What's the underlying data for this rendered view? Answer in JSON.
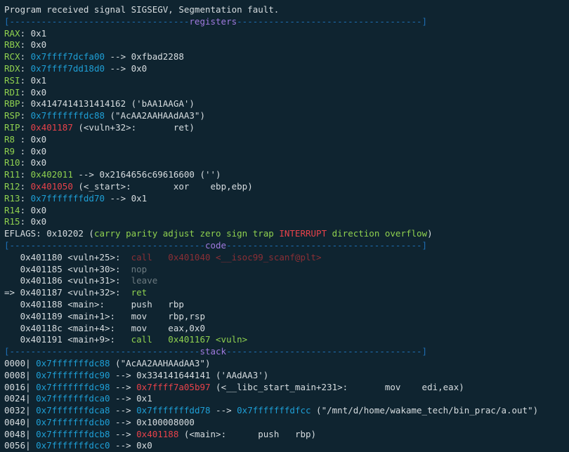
{
  "terminal": {
    "lines": [
      [
        {
          "t": "Program received signal SIGSEGV, Segmentation fault.",
          "c": "default"
        }
      ],
      [
        {
          "t": "[----------------------------------",
          "c": "sep"
        },
        {
          "t": "registers",
          "c": "purple"
        },
        {
          "t": "-----------------------------------]",
          "c": "sep"
        }
      ],
      [
        {
          "t": "RAX",
          "c": "green"
        },
        {
          "t": ": 0x1",
          "c": "default"
        }
      ],
      [
        {
          "t": "RBX",
          "c": "green"
        },
        {
          "t": ": 0x0",
          "c": "default"
        }
      ],
      [
        {
          "t": "RCX",
          "c": "green"
        },
        {
          "t": ": ",
          "c": "default"
        },
        {
          "t": "0x7ffff7dcfa00",
          "c": "blue"
        },
        {
          "t": " --> 0xfbad2288",
          "c": "default"
        }
      ],
      [
        {
          "t": "RDX",
          "c": "green"
        },
        {
          "t": ": ",
          "c": "default"
        },
        {
          "t": "0x7ffff7dd18d0",
          "c": "blue"
        },
        {
          "t": " --> 0x0",
          "c": "default"
        }
      ],
      [
        {
          "t": "RSI",
          "c": "green"
        },
        {
          "t": ": 0x1",
          "c": "default"
        }
      ],
      [
        {
          "t": "RDI",
          "c": "green"
        },
        {
          "t": ": 0x0",
          "c": "default"
        }
      ],
      [
        {
          "t": "RBP",
          "c": "green"
        },
        {
          "t": ": 0x4147414131414162 ('bAA1AAGA')",
          "c": "default"
        }
      ],
      [
        {
          "t": "RSP",
          "c": "green"
        },
        {
          "t": ": ",
          "c": "default"
        },
        {
          "t": "0x7fffffffdc88",
          "c": "blue"
        },
        {
          "t": " (\"AcAA2AAHAAdAA3\")",
          "c": "default"
        }
      ],
      [
        {
          "t": "RIP",
          "c": "green"
        },
        {
          "t": ": ",
          "c": "default"
        },
        {
          "t": "0x401187",
          "c": "red"
        },
        {
          "t": " (<vuln+32>:       ret)",
          "c": "default"
        }
      ],
      [
        {
          "t": "R8 ",
          "c": "green"
        },
        {
          "t": ": 0x0",
          "c": "default"
        }
      ],
      [
        {
          "t": "R9 ",
          "c": "green"
        },
        {
          "t": ": 0x0",
          "c": "default"
        }
      ],
      [
        {
          "t": "R10",
          "c": "green"
        },
        {
          "t": ": 0x0",
          "c": "default"
        }
      ],
      [
        {
          "t": "R11",
          "c": "green"
        },
        {
          "t": ": ",
          "c": "default"
        },
        {
          "t": "0x402011",
          "c": "green"
        },
        {
          "t": " --> 0x2164656c69616600 ('')",
          "c": "default"
        }
      ],
      [
        {
          "t": "R12",
          "c": "green"
        },
        {
          "t": ": ",
          "c": "default"
        },
        {
          "t": "0x401050",
          "c": "red"
        },
        {
          "t": " (<_start>:        xor    ebp,ebp)",
          "c": "default"
        }
      ],
      [
        {
          "t": "R13",
          "c": "green"
        },
        {
          "t": ": ",
          "c": "default"
        },
        {
          "t": "0x7fffffffdd70",
          "c": "blue"
        },
        {
          "t": " --> 0x1",
          "c": "default"
        }
      ],
      [
        {
          "t": "R14",
          "c": "green"
        },
        {
          "t": ": 0x0",
          "c": "default"
        }
      ],
      [
        {
          "t": "R15",
          "c": "green"
        },
        {
          "t": ": 0x0",
          "c": "default"
        }
      ],
      [
        {
          "t": "EFLAGS",
          "c": "default"
        },
        {
          "t": ": 0x10202 (",
          "c": "default"
        },
        {
          "t": "carry parity adjust zero sign trap ",
          "c": "green"
        },
        {
          "t": "INTERRUPT",
          "c": "red"
        },
        {
          "t": " direction overflow",
          "c": "green"
        },
        {
          "t": ")",
          "c": "default"
        }
      ],
      [
        {
          "t": "[-------------------------------------",
          "c": "sep"
        },
        {
          "t": "code",
          "c": "purple"
        },
        {
          "t": "-------------------------------------]",
          "c": "sep"
        }
      ],
      [
        {
          "t": "   0x401180 <vuln+25>:  ",
          "c": "default"
        },
        {
          "t": "call   0x401040 <__isoc99_scanf@plt>",
          "c": "dim-red"
        }
      ],
      [
        {
          "t": "   0x401185 <vuln+30>:  ",
          "c": "default"
        },
        {
          "t": "nop",
          "c": "grey"
        }
      ],
      [
        {
          "t": "   0x401186 <vuln+31>:  ",
          "c": "default"
        },
        {
          "t": "leave",
          "c": "grey"
        }
      ],
      [
        {
          "t": "=> 0x401187 <vuln+32>:  ",
          "c": "default"
        },
        {
          "t": "ret",
          "c": "green"
        }
      ],
      [
        {
          "t": "   0x401188 <main>:     push   rbp",
          "c": "default"
        }
      ],
      [
        {
          "t": "   0x401189 <main+1>:   mov    rbp,rsp",
          "c": "default"
        }
      ],
      [
        {
          "t": "   0x40118c <main+4>:   mov    eax,0x0",
          "c": "default"
        }
      ],
      [
        {
          "t": "   0x401191 <main+9>:   ",
          "c": "default"
        },
        {
          "t": "call   0x401167 <vuln>",
          "c": "green"
        }
      ],
      [
        {
          "t": "[------------------------------------",
          "c": "sep"
        },
        {
          "t": "stack",
          "c": "purple"
        },
        {
          "t": "-------------------------------------]",
          "c": "sep"
        }
      ],
      [
        {
          "t": "0000| ",
          "c": "default"
        },
        {
          "t": "0x7fffffffdc88",
          "c": "blue"
        },
        {
          "t": " (\"AcAA2AAHAAdAA3\")",
          "c": "default"
        }
      ],
      [
        {
          "t": "0008| ",
          "c": "default"
        },
        {
          "t": "0x7fffffffdc90",
          "c": "blue"
        },
        {
          "t": " --> 0x334141644141 ('AAdAA3')",
          "c": "default"
        }
      ],
      [
        {
          "t": "0016| ",
          "c": "default"
        },
        {
          "t": "0x7fffffffdc98",
          "c": "blue"
        },
        {
          "t": " --> ",
          "c": "default"
        },
        {
          "t": "0x7ffff7a05b97",
          "c": "red"
        },
        {
          "t": " (<__libc_start_main+231>:       mov    edi,eax)",
          "c": "default"
        }
      ],
      [
        {
          "t": "0024| ",
          "c": "default"
        },
        {
          "t": "0x7fffffffdca0",
          "c": "blue"
        },
        {
          "t": " --> 0x1",
          "c": "default"
        }
      ],
      [
        {
          "t": "0032| ",
          "c": "default"
        },
        {
          "t": "0x7fffffffdca8",
          "c": "blue"
        },
        {
          "t": " --> ",
          "c": "default"
        },
        {
          "t": "0x7fffffffdd78",
          "c": "blue"
        },
        {
          "t": " --> ",
          "c": "default"
        },
        {
          "t": "0x7fffffffdfcc",
          "c": "blue"
        },
        {
          "t": " (\"/mnt/d/home/wakame_tech/bin_prac/a.out\")",
          "c": "default"
        }
      ],
      [
        {
          "t": "0040| ",
          "c": "default"
        },
        {
          "t": "0x7fffffffdcb0",
          "c": "blue"
        },
        {
          "t": " --> 0x100008000",
          "c": "default"
        }
      ],
      [
        {
          "t": "0048| ",
          "c": "default"
        },
        {
          "t": "0x7fffffffdcb8",
          "c": "blue"
        },
        {
          "t": " --> ",
          "c": "default"
        },
        {
          "t": "0x401188",
          "c": "red"
        },
        {
          "t": " (<main>:      push   rbp)",
          "c": "default"
        }
      ],
      [
        {
          "t": "0056| ",
          "c": "default"
        },
        {
          "t": "0x7fffffffdcc0",
          "c": "blue"
        },
        {
          "t": " --> 0x0",
          "c": "default"
        }
      ]
    ]
  },
  "colors": {
    "background": "#0f2430",
    "default": "#d7dde0",
    "green": "#8fd14f",
    "blue": "#1e9fd6",
    "red": "#e8424a",
    "purple": "#a07adf",
    "separator": "#1e6fb5"
  }
}
